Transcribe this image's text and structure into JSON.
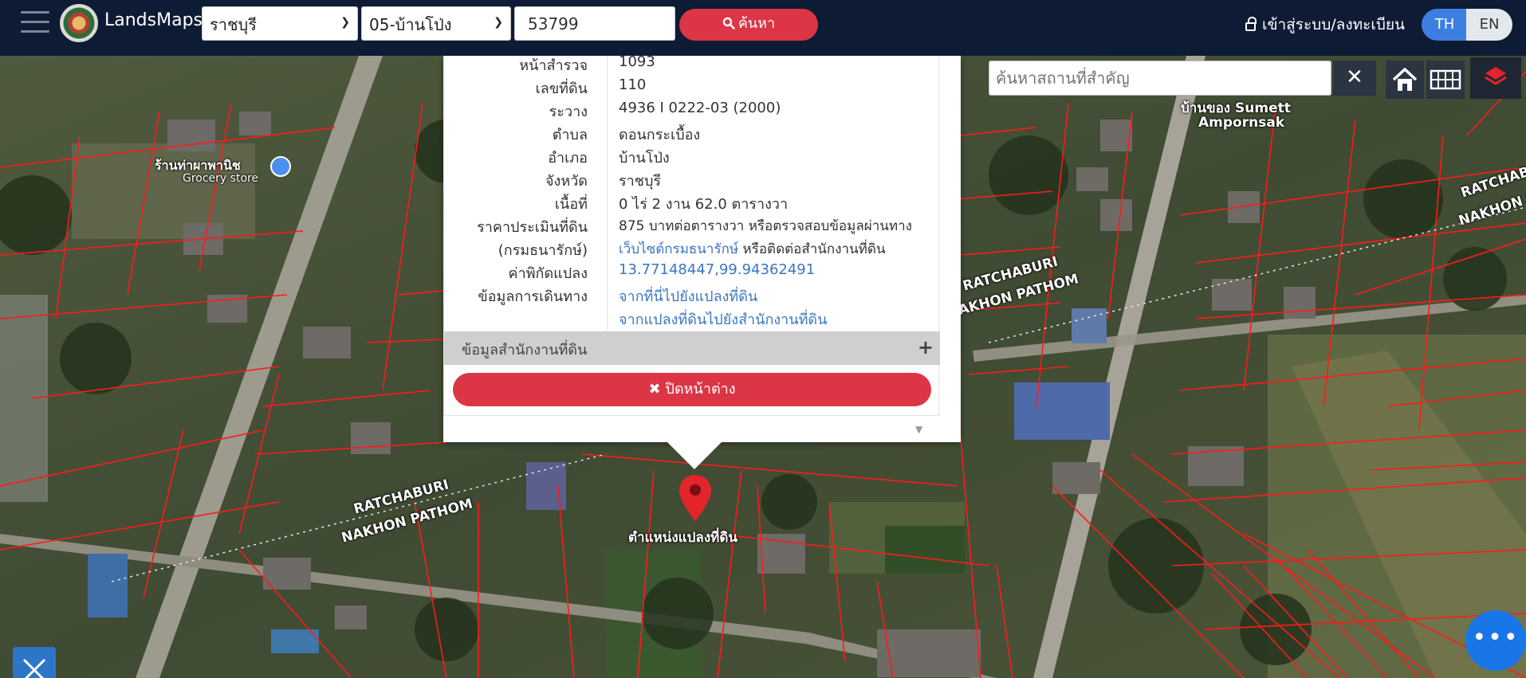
{
  "header": {
    "brand": "LandsMaps",
    "province": "ราชบุรี",
    "district": "05-บ้านโป่ง",
    "parcel_number": "53799",
    "search_label": "ค้นหา",
    "login_label": "เข้าสู่ระบบ/ลงทะเบียน",
    "lang_th": "TH",
    "lang_en": "EN"
  },
  "map": {
    "place_search_placeholder": "ค้นหาสถานที่สำคัญ",
    "labels": {
      "store_name": "ร้านท่าผาพานิช",
      "store_type": "Grocery store",
      "owner_thai": "บ้านของ Sumett",
      "owner_name": "Amporn​sak",
      "ratchaburi_1": "RATCHABURI",
      "nakhon_1": "NAKHON PATHOM",
      "ratchaburi_2": "RATCHABURI",
      "nakhon_2": "NAKHON PATHOM",
      "ratchaburi_3": "RATCHABURI",
      "nakhon_3": "NAKHON PATHOM",
      "marker_label": "ตำแหน่งแปลงที่ดิน"
    }
  },
  "popup": {
    "rows": [
      {
        "label": "หน้าสำรวจ",
        "value": "1093"
      },
      {
        "label": "เลขที่ดิน",
        "value": "110"
      },
      {
        "label": "ระวาง",
        "value": "4936 I 0222-03 (2000)"
      },
      {
        "label": "ตำบล",
        "value": "ดอนกระเบื้อง"
      },
      {
        "label": "อำเภอ",
        "value": "บ้านโป่ง"
      },
      {
        "label": "จังหวัด",
        "value": "ราชบุรี"
      },
      {
        "label": "เนื้อที่",
        "value": "0 ไร่ 2 งาน 62.0 ตารางวา"
      }
    ],
    "price_label_1": "ราคาประเมินที่ดิน",
    "price_label_2": "(กรมธนารักษ์)",
    "price_value_1": "875 บาทต่อตารางวา หรือตรวจสอบข้อมูลผ่านทาง",
    "price_link": "เว็บไซต์กรมธนารักษ์",
    "price_value_2": " หรือติดต่อสำนักงานที่ดิน",
    "coord_label": "ค่าพิกัดแปลง",
    "coord_value": "13.77148447,99.94362491",
    "travel_label": "ข้อมูลการเดินทาง",
    "travel_link_1": "จากที่นี่ไปยังแปลงที่ดิน",
    "travel_link_2": "จากแปลงที่ดินไปยังสำนักงานที่ดิน",
    "office_section": "ข้อมูลสำนักงานที่ดิน",
    "close_label": "ปิดหน้าต่าง"
  },
  "icons": {
    "search": "search-icon",
    "close": "close-icon",
    "home": "home-icon",
    "grid": "grid-icon",
    "layers": "layers-icon",
    "measure": "measure-icon",
    "more": "more-icon",
    "pin": "map-pin-icon"
  },
  "colors": {
    "header": "#0d1b34",
    "accent_red": "#dc3545",
    "accent_blue": "#3d7fe0",
    "parcel_line": "#ff1a1a"
  }
}
